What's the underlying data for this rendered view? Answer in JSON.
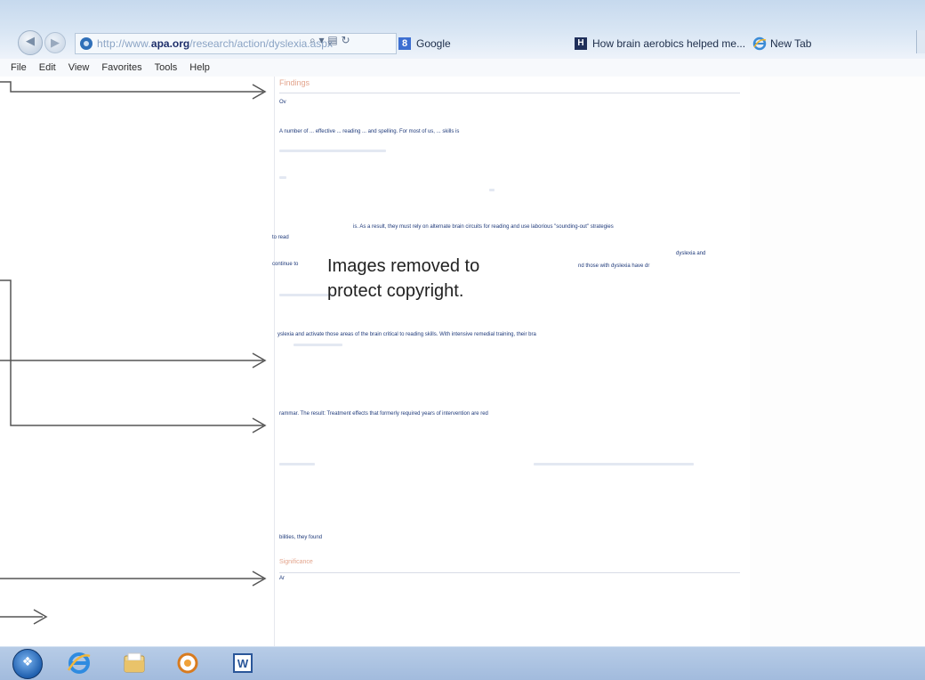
{
  "browser": {
    "url_scheme": "http://www.",
    "url_host": "apa.org",
    "url_path": "/research/action/dyslexia.aspx",
    "address_controls": "⌕ ▾ ▤ ↻",
    "tabs": [
      {
        "label": "Google",
        "icon": "google-icon"
      },
      {
        "label": "How brain aerobics helped me...",
        "icon": "huffpost-icon"
      },
      {
        "label": "New Tab",
        "icon": "ie-icon"
      }
    ]
  },
  "menu": {
    "items": [
      "File",
      "Edit",
      "View",
      "Favorites",
      "Tools",
      "Help"
    ]
  },
  "content": {
    "findings_heading": "Findings",
    "line_1": "Ov",
    "line_2": "A number of ... effective ... reading ... and spelling. For most of us, ... skills is",
    "line_3": "is. As a result, they must rely on alternate brain circuits for reading and use laborious \"sounding-out\" strategies",
    "line_4": "to read",
    "line_5a": "continue to",
    "line_5b": "nd those with dyslexia have dr",
    "line_5c": "dyslexia and",
    "line_6": "yslexia and activate those areas of the brain critical to reading skills. With intensive remedial training, their bra",
    "line_7": "rammar. The result: Treatment effects that formerly required years of intervention are red",
    "line_8": "bilities, they found",
    "significance_heading": "Significance",
    "line_9": "Ar",
    "copyright_notice": "Images removed to\nprotect copyright."
  },
  "taskbar": {
    "apps": [
      "start-button",
      "internet-explorer",
      "file-explorer",
      "media-player",
      "microsoft-word"
    ]
  },
  "colors": {
    "chrome": "#c6d9ee",
    "heading": "#e3a48c",
    "body_text": "#1f3a7a",
    "taskbar": "#a2bbdd"
  }
}
